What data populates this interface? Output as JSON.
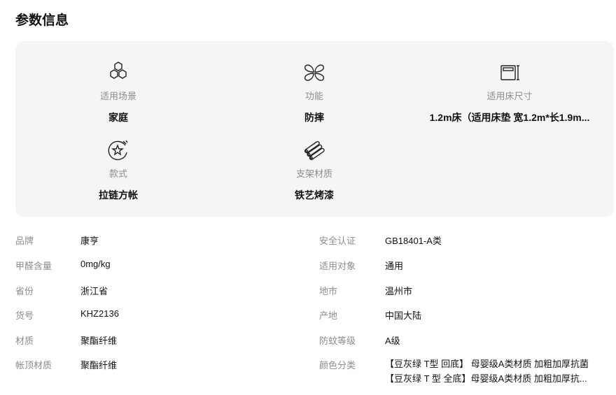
{
  "section": {
    "title": "参数信息"
  },
  "features": [
    {
      "icon": "hexagon-cluster-icon",
      "label": "适用场景",
      "value": "家庭"
    },
    {
      "icon": "clover-petals-icon",
      "label": "功能",
      "value": "防摔"
    },
    {
      "icon": "bed-frame-icon",
      "label": "适用床尺寸",
      "value": "1.2m床（适用床垫 宽1.2m*长1.9m..."
    },
    {
      "icon": "star-circle-icon",
      "label": "款式",
      "value": "拉链方帐"
    },
    {
      "icon": "pipe-bundle-icon",
      "label": "支架材质",
      "value": "铁艺烤漆"
    }
  ],
  "specs_left": [
    {
      "key": "品牌",
      "value": "康亨"
    },
    {
      "key": "甲醛含量",
      "value": "0mg/kg"
    },
    {
      "key": "省份",
      "value": "浙江省"
    },
    {
      "key": "货号",
      "value": "KHZ2136"
    },
    {
      "key": "材质",
      "value": "聚酯纤维"
    },
    {
      "key": "帐顶材质",
      "value": "聚酯纤维"
    }
  ],
  "specs_right": [
    {
      "key": "安全认证",
      "value": "GB18401-A类"
    },
    {
      "key": "适用对象",
      "value": "通用"
    },
    {
      "key": "地市",
      "value": "温州市"
    },
    {
      "key": "产地",
      "value": "中国大陆"
    },
    {
      "key": "防蚊等级",
      "value": "A级"
    }
  ],
  "color_spec": {
    "key": "颜色分类",
    "values": [
      "【豆灰绿 T型 回底】 母婴级A类材质 加粗加厚抗菌",
      "【豆灰绿 T 型 全底】母婴级A类材质 加粗加厚抗..."
    ]
  }
}
